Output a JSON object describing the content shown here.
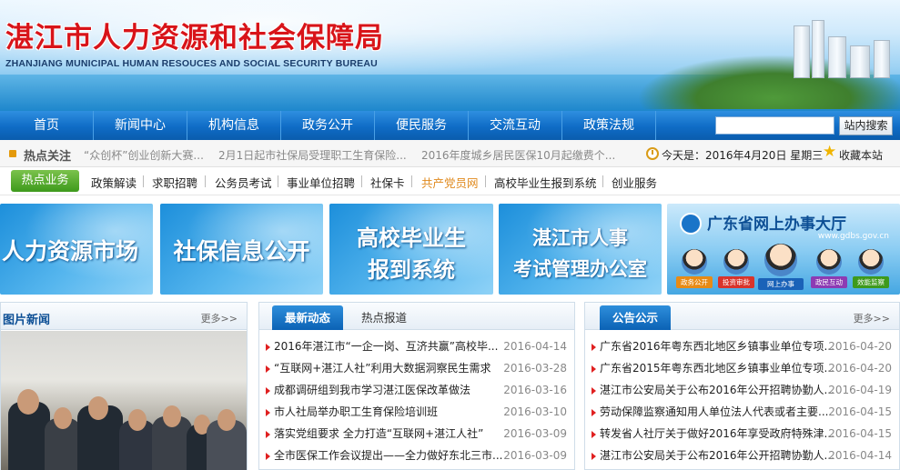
{
  "header": {
    "title": "湛江市人力资源和社会保障局",
    "subtitle": "ZHANJIANG MUNICIPAL HUMAN RESOUCES AND SOCIAL SECURITY BUREAU"
  },
  "nav": {
    "items": [
      "首页",
      "新闻中心",
      "机构信息",
      "政务公开",
      "便民服务",
      "交流互动",
      "政策法规"
    ],
    "search_button": "站内搜索",
    "search_value": ""
  },
  "hotbar": {
    "label": "热点关注",
    "items": [
      "“众创杯”创业创新大赛...",
      "2月1日起市社保局受理职工生育保险...",
      "2016年度城乡居民医保10月起缴费个..."
    ],
    "today": "今天是：2016年4月20日 星期三",
    "bookmark": "收藏本站"
  },
  "subnav": {
    "hot_label": "热点业务",
    "items": [
      "政策解读",
      "求职招聘",
      "公务员考试",
      "事业单位招聘",
      "社保卡",
      "共产党员网",
      "高校毕业生报到系统",
      "创业服务"
    ],
    "highlight_color": "#e08a1e"
  },
  "banners": {
    "b1": "人力资源市场",
    "b2": "社保信息公开",
    "b3_line1": "高校毕业生",
    "b3_line2": "报到系统",
    "b4_line1": "湛江市人事",
    "b4_line2": "考试管理办公室",
    "b5_title": "广东省网上办事大厅",
    "b5_url": "www.gdbs.gov.cn",
    "services": [
      "政务公开",
      "投资审批",
      "网上办事",
      "政民互动",
      "效能监察"
    ]
  },
  "photo_news": {
    "title": "图片新闻",
    "more": "更多>>"
  },
  "latest": {
    "tab_active": "最新动态",
    "tab_inactive": "热点报道",
    "items": [
      {
        "title": "2016年湛江市“一企一岗、互济共赢”高校毕...",
        "date": "2016-04-14"
      },
      {
        "title": "“互联网+湛江人社”利用大数据洞察民生需求",
        "date": "2016-03-28"
      },
      {
        "title": "成都调研组到我市学习湛江医保改革做法",
        "date": "2016-03-16"
      },
      {
        "title": "市人社局举办职工生育保险培训班",
        "date": "2016-03-10"
      },
      {
        "title": "落实党组要求 全力打造“互联网+湛江人社”",
        "date": "2016-03-09"
      },
      {
        "title": "全市医保工作会议提出——全力做好东北三市...",
        "date": "2016-03-09"
      }
    ]
  },
  "notices": {
    "tab": "公告公示",
    "more": "更多>>",
    "items": [
      {
        "title": "广东省2016年粤东西北地区乡镇事业单位专项...",
        "date": "2016-04-20"
      },
      {
        "title": "广东省2015年粤东西北地区乡镇事业单位专项...",
        "date": "2016-04-20"
      },
      {
        "title": "湛江市公安局关于公布2016年公开招聘协勤人...",
        "date": "2016-04-19"
      },
      {
        "title": "劳动保障监察通知用人单位法人代表或者主要...",
        "date": "2016-04-15"
      },
      {
        "title": "转发省人社厅关于做好2016年享受政府特殊津...",
        "date": "2016-04-15"
      },
      {
        "title": "湛江市公安局关于公布2016年公开招聘协勤人...",
        "date": "2016-04-14"
      }
    ]
  },
  "colors": {
    "title_red": "#d81419",
    "nav_blue": "#0f6cc6",
    "green_btn": "#3e9a1c",
    "arrow_red": "#e02020"
  }
}
